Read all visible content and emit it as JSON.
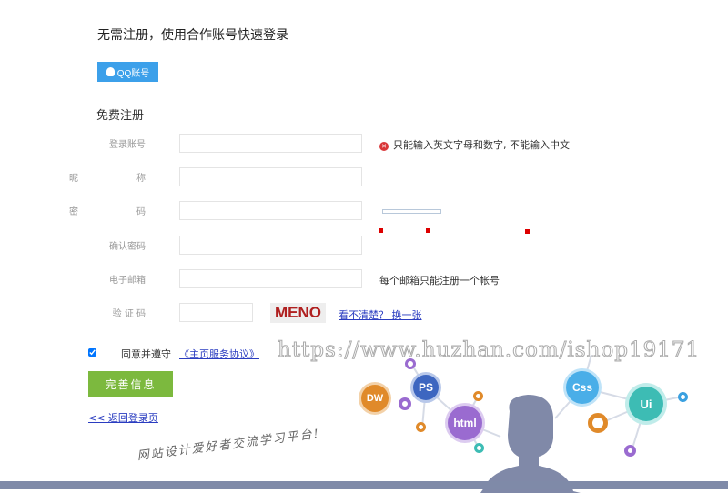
{
  "quick_login": {
    "title": "无需注册，使用合作账号快速登录",
    "qq_label": "QQ账号"
  },
  "register": {
    "title": "免费注册",
    "fields": {
      "account": {
        "label": "登录账号",
        "message": "只能输入英文字母和数字, 不能输入中文"
      },
      "nickname": {
        "label_a": "昵",
        "label_b": "称"
      },
      "password": {
        "label_a": "密",
        "label_b": "码"
      },
      "confirm": {
        "label": "确认密码"
      },
      "email": {
        "label": "电子邮箱",
        "message": "每个邮箱只能注册一个帐号"
      },
      "captcha": {
        "label": "验 证 码",
        "image_text": "MENO",
        "refresh_label": "看不清楚？ 换一张"
      }
    },
    "agree_label": "同意并遵守",
    "agreement_link": "《主页服务协议》",
    "agree_checked": true,
    "submit_label": "完善信息",
    "back_link": "<< 返回登录页"
  },
  "banner": {
    "slogan": "网站设计爱好者交流学习平台!",
    "skills": [
      "DW",
      "PS",
      "html",
      "Css",
      "Ui"
    ]
  },
  "watermark": "https://www.huzhan.com/ishop19171",
  "colors": {
    "qq": "#3ca0ea",
    "submit": "#7cb93e",
    "error": "#d9383a",
    "link": "#2a3cc0"
  }
}
